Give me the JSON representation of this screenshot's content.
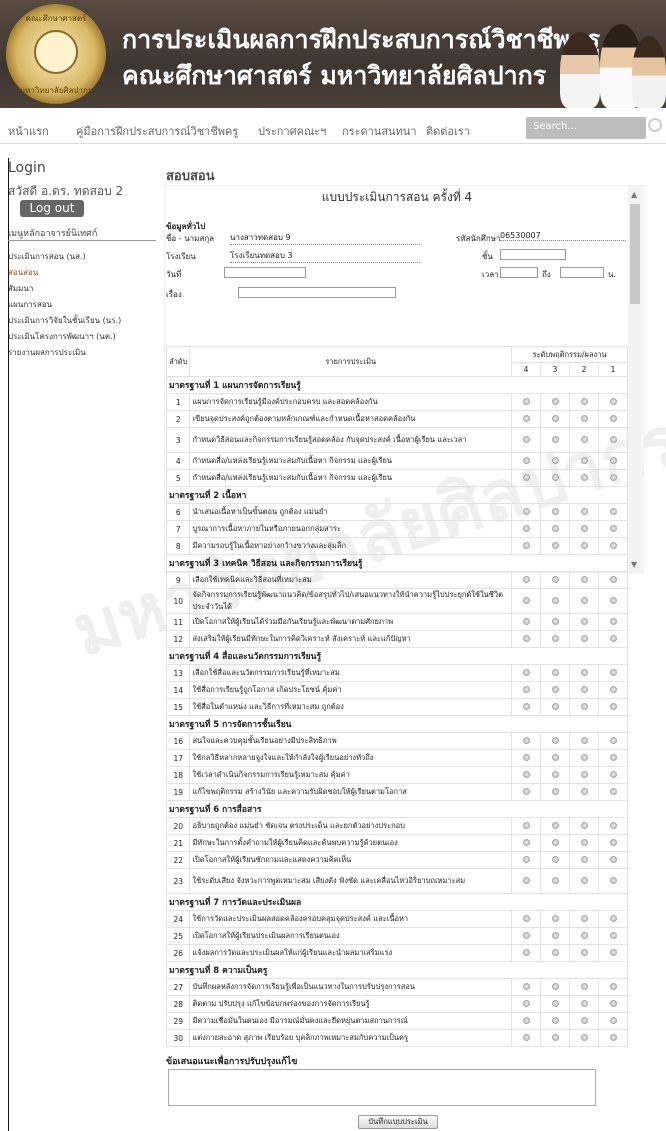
{
  "banner": {
    "line1": "การประเมินผลการฝึกประสบการณ์วิชาชีพครู",
    "line2": "คณะศึกษาศาสตร์ มหาวิทยาลัยศิลปากร",
    "logo_top": "คณะศึกษาศาสตร์",
    "logo_bottom": "มหาวิทยาลัยศิลปากร"
  },
  "nav": {
    "items": [
      "หน้าแรก",
      "คู่มือการฝึกประสบการณ์วิชาชีพครู",
      "ประกาศคณะฯ",
      "กระดานสนทนา",
      "ติดต่อเรา"
    ],
    "search_placeholder": "Search..."
  },
  "sidebar": {
    "login": "Login",
    "greeting": "สวัสดี อ.ดร. ทดสอบ 2",
    "logout": "Log out",
    "advisor": "เมนูหลักอาจารย์นิเทศก์",
    "items": [
      "ประเมินการสอน (นส.)",
      "สอนสอน",
      "สัมมนา",
      "แผนการสอน",
      "ประเมินการวิจัยในชั้นเรียน (นร.)",
      "ประเมินโครงการพัฒนาฯ (นค.)",
      "รายงานผลการประเมิน"
    ]
  },
  "main": {
    "title": "สอบสอน",
    "form_title": "แบบประเมินการสอน ครั้งที่ 4"
  },
  "general": {
    "heading": "ข้อมูลทั่วไป",
    "name_label": "ชื่อ - นามสกุล",
    "name_value": "นางสาวทดสอบ 9",
    "id_label": "รหัสนักศึกษา",
    "id_value": "06530007",
    "school_label": "โรงเรียน",
    "school_value": "โรงเรียนทดสอบ 3",
    "grade_label": "ชั้น",
    "date_label": "วันที่",
    "time_label": "เวลา",
    "to_label": "ถึง",
    "unit": "น.",
    "topic_label": "เรื่อง"
  },
  "table": {
    "col_no": "ลำดับ",
    "col_item": "รายการประเมิน",
    "col_level": "ระดับพฤติกรรม/ผลงาน",
    "levels": [
      "4",
      "3",
      "2",
      "1"
    ]
  },
  "standards": [
    {
      "title": "มาตรฐานที่ 1 แผนการจัดการเรียนรู้",
      "items": [
        [
          "1",
          "แผนการจัดการเรียนรู้มีองค์ประกอบครบ และสอดคล้องกัน"
        ],
        [
          "2",
          "เขียนจุดประสงค์ถูกต้องตามหลักเกณฑ์และกำหนดเนื้อหาสอดคล้องกัน"
        ],
        [
          "3",
          "กำหนดวิธีสอนและกิจกรรมการเรียนรู้สอดคล้อง กับจุดประสงค์ เนื้อหาผู้เรียน และเวลา"
        ],
        [
          "4",
          "กำหนดสื่อ/แหล่งเรียนรู้เหมาะสมกับเนื้อหา กิจกรรม และผู้เรียน"
        ],
        [
          "5",
          "กำหนดสื่อ/แหล่งเรียนรู้เหมาะสมกับเนื้อหา กิจกรรม และผู้เรียน"
        ]
      ]
    },
    {
      "title": "มาตรฐานที่ 2 เนื้อหา",
      "items": [
        [
          "6",
          "นำเสนอเนื้อหาเป็นขั้นตอน ถูกต้อง แม่นยำ"
        ],
        [
          "7",
          "บูรณาการเนื้อหาภายในหรือภายนอกกลุ่มสาระ"
        ],
        [
          "8",
          "มีความรอบรู้ในเนื้อหาอย่างกว้างขวางและลุ่มลึก"
        ]
      ]
    },
    {
      "title": "มาตรฐานที่ 3 เทคนิค วิธีสอน และกิจกรรมการเรียนรู้",
      "items": [
        [
          "9",
          "เลือกใช้เทคนิคและวิธีสอนที่เหมาะสม"
        ],
        [
          "10",
          "จัดกิจกรรมการเรียนรู้พัฒนาแนวคิด/ข้อสรุปทั่วไป/เสนอแนวทางให้นำความรู้ไปประยุกต์ใช้ในชีวิตประจำวันได้"
        ],
        [
          "11",
          "เปิดโอกาสให้ผู้เรียนได้ร่วมมือกันเรียนรู้และพัฒนาตามศักยภาพ"
        ],
        [
          "12",
          "ส่งเสริมให้ผู้เรียนมีทักษะในการคิดวิเคราะห์ สังเคราะห์ และแก้ปัญหา"
        ]
      ]
    },
    {
      "title": "มาตรฐานที่ 4 สื่อและนวัตกรรมการเรียนรู้",
      "items": [
        [
          "13",
          "เลือกใช้สื่อและนวัตกรรมการเรียนรู้ที่เหมาะสม"
        ],
        [
          "14",
          "ใช้สื่อการเรียนรู้ถูกโอกาส เกิดประโยชน์ คุ้มค่า"
        ],
        [
          "15",
          "ใช้สื่อในตำแหน่ง และวิธีการที่เหมาะสม ถูกต้อง"
        ]
      ]
    },
    {
      "title": "มาตรฐานที่ 5 การจัดการชั้นเรียน",
      "items": [
        [
          "16",
          "สนใจและควบคุมชั้นเรียนอย่างมีประสิทธิภาพ"
        ],
        [
          "17",
          "ใช้กลวิธีหลากหลายจูงใจและให้กำลังใจผู้เรียนอย่างทั่วถึง"
        ],
        [
          "18",
          "ใช้เวลาดำเนินกิจกรรมการเรียนรู้เหมาะสม คุ้มค่า"
        ],
        [
          "19",
          "แก้ไขพฤติกรรม สร้างวินัย และความรับผิดชอบให้ผู้เรียนตามโอกาส"
        ]
      ]
    },
    {
      "title": "มาตรฐานที่ 6 การสื่อสาร",
      "items": [
        [
          "20",
          "อธิบายถูกต้อง แม่นยำ ชัดเจน ตรงประเด็น และยกตัวอย่างประกอบ"
        ],
        [
          "21",
          "มีทักษะในการตั้งคำถามให้ผู้เรียนคิดและค้นพบความรู้ด้วยตนเอง"
        ],
        [
          "22",
          "เปิดโอกาสให้ผู้เรียนซักถามและแสดงความคิดเห็น"
        ],
        [
          "23",
          "ใช้ระดับเสียง จังหวะการพูดเหมาะสม เสียงดัง ฟังชัด และเคลื่อนไหวอิริยาบถเหมาะสม"
        ]
      ]
    },
    {
      "title": "มาตรฐานที่ 7 การวัดและประเมินผล",
      "items": [
        [
          "24",
          "ใช้การวัดและประเมินผลสอดคล้องครอบคลุมจุดประสงค์ และเนื้อหา"
        ],
        [
          "25",
          "เปิดโอกาสให้ผู้เรียนประเมินผลการเรียนตนเอง"
        ],
        [
          "26",
          "แจ้งผลการวัดและประเมินผลให้แก่ผู้เรียนและนำผลมาเสริมแรง"
        ]
      ]
    },
    {
      "title": "มาตรฐานที่ 8 ความเป็นครู",
      "items": [
        [
          "27",
          "บันทึกผลหลังการจัดการเรียนรู้เพื่อเป็นแนวทางในการปรับปรุงการสอน"
        ],
        [
          "28",
          "ติดตาม ปรับปรุง แก้ไขข้อบกพร่องของการจัดการเรียนรู้"
        ],
        [
          "29",
          "มีความเชื่อมั่นในตนเอง มีอารมณ์มั่นคงและยืดหยุ่นตามสถานการณ์"
        ],
        [
          "30",
          "แต่งกายสะอาด สุภาพ เรียบร้อย บุคลิกภาพเหมาะสมกับความเป็นครู"
        ]
      ]
    }
  ],
  "footer": {
    "suggestion_label": "ข้อเสนอแนะเพื่อการปรับปรุงแก้ไข",
    "save": "บันทึกแบบประเมิน"
  }
}
